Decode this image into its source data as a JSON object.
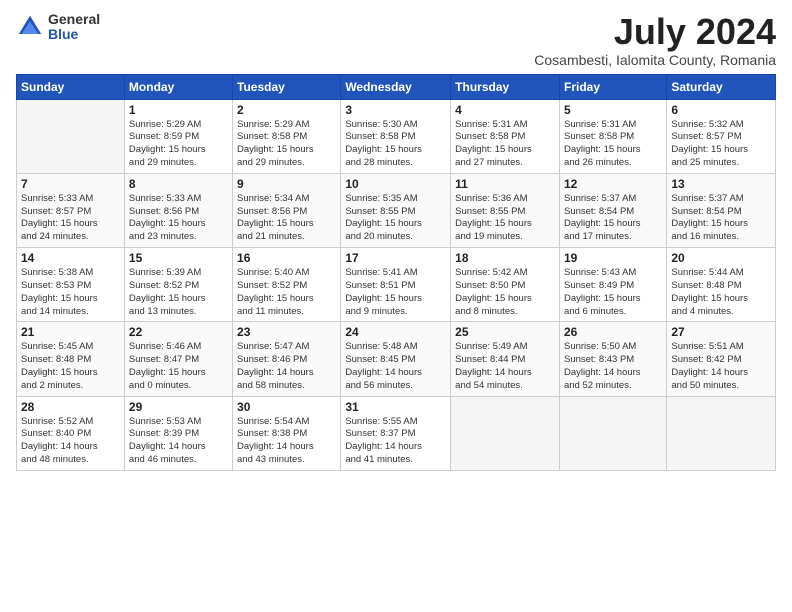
{
  "logo": {
    "general": "General",
    "blue": "Blue"
  },
  "title": "July 2024",
  "location": "Cosambesti, Ialomita County, Romania",
  "days_header": [
    "Sunday",
    "Monday",
    "Tuesday",
    "Wednesday",
    "Thursday",
    "Friday",
    "Saturday"
  ],
  "weeks": [
    [
      {
        "day": "",
        "info": ""
      },
      {
        "day": "1",
        "info": "Sunrise: 5:29 AM\nSunset: 8:59 PM\nDaylight: 15 hours\nand 29 minutes."
      },
      {
        "day": "2",
        "info": "Sunrise: 5:29 AM\nSunset: 8:58 PM\nDaylight: 15 hours\nand 29 minutes."
      },
      {
        "day": "3",
        "info": "Sunrise: 5:30 AM\nSunset: 8:58 PM\nDaylight: 15 hours\nand 28 minutes."
      },
      {
        "day": "4",
        "info": "Sunrise: 5:31 AM\nSunset: 8:58 PM\nDaylight: 15 hours\nand 27 minutes."
      },
      {
        "day": "5",
        "info": "Sunrise: 5:31 AM\nSunset: 8:58 PM\nDaylight: 15 hours\nand 26 minutes."
      },
      {
        "day": "6",
        "info": "Sunrise: 5:32 AM\nSunset: 8:57 PM\nDaylight: 15 hours\nand 25 minutes."
      }
    ],
    [
      {
        "day": "7",
        "info": "Sunrise: 5:33 AM\nSunset: 8:57 PM\nDaylight: 15 hours\nand 24 minutes."
      },
      {
        "day": "8",
        "info": "Sunrise: 5:33 AM\nSunset: 8:56 PM\nDaylight: 15 hours\nand 23 minutes."
      },
      {
        "day": "9",
        "info": "Sunrise: 5:34 AM\nSunset: 8:56 PM\nDaylight: 15 hours\nand 21 minutes."
      },
      {
        "day": "10",
        "info": "Sunrise: 5:35 AM\nSunset: 8:55 PM\nDaylight: 15 hours\nand 20 minutes."
      },
      {
        "day": "11",
        "info": "Sunrise: 5:36 AM\nSunset: 8:55 PM\nDaylight: 15 hours\nand 19 minutes."
      },
      {
        "day": "12",
        "info": "Sunrise: 5:37 AM\nSunset: 8:54 PM\nDaylight: 15 hours\nand 17 minutes."
      },
      {
        "day": "13",
        "info": "Sunrise: 5:37 AM\nSunset: 8:54 PM\nDaylight: 15 hours\nand 16 minutes."
      }
    ],
    [
      {
        "day": "14",
        "info": "Sunrise: 5:38 AM\nSunset: 8:53 PM\nDaylight: 15 hours\nand 14 minutes."
      },
      {
        "day": "15",
        "info": "Sunrise: 5:39 AM\nSunset: 8:52 PM\nDaylight: 15 hours\nand 13 minutes."
      },
      {
        "day": "16",
        "info": "Sunrise: 5:40 AM\nSunset: 8:52 PM\nDaylight: 15 hours\nand 11 minutes."
      },
      {
        "day": "17",
        "info": "Sunrise: 5:41 AM\nSunset: 8:51 PM\nDaylight: 15 hours\nand 9 minutes."
      },
      {
        "day": "18",
        "info": "Sunrise: 5:42 AM\nSunset: 8:50 PM\nDaylight: 15 hours\nand 8 minutes."
      },
      {
        "day": "19",
        "info": "Sunrise: 5:43 AM\nSunset: 8:49 PM\nDaylight: 15 hours\nand 6 minutes."
      },
      {
        "day": "20",
        "info": "Sunrise: 5:44 AM\nSunset: 8:48 PM\nDaylight: 15 hours\nand 4 minutes."
      }
    ],
    [
      {
        "day": "21",
        "info": "Sunrise: 5:45 AM\nSunset: 8:48 PM\nDaylight: 15 hours\nand 2 minutes."
      },
      {
        "day": "22",
        "info": "Sunrise: 5:46 AM\nSunset: 8:47 PM\nDaylight: 15 hours\nand 0 minutes."
      },
      {
        "day": "23",
        "info": "Sunrise: 5:47 AM\nSunset: 8:46 PM\nDaylight: 14 hours\nand 58 minutes."
      },
      {
        "day": "24",
        "info": "Sunrise: 5:48 AM\nSunset: 8:45 PM\nDaylight: 14 hours\nand 56 minutes."
      },
      {
        "day": "25",
        "info": "Sunrise: 5:49 AM\nSunset: 8:44 PM\nDaylight: 14 hours\nand 54 minutes."
      },
      {
        "day": "26",
        "info": "Sunrise: 5:50 AM\nSunset: 8:43 PM\nDaylight: 14 hours\nand 52 minutes."
      },
      {
        "day": "27",
        "info": "Sunrise: 5:51 AM\nSunset: 8:42 PM\nDaylight: 14 hours\nand 50 minutes."
      }
    ],
    [
      {
        "day": "28",
        "info": "Sunrise: 5:52 AM\nSunset: 8:40 PM\nDaylight: 14 hours\nand 48 minutes."
      },
      {
        "day": "29",
        "info": "Sunrise: 5:53 AM\nSunset: 8:39 PM\nDaylight: 14 hours\nand 46 minutes."
      },
      {
        "day": "30",
        "info": "Sunrise: 5:54 AM\nSunset: 8:38 PM\nDaylight: 14 hours\nand 43 minutes."
      },
      {
        "day": "31",
        "info": "Sunrise: 5:55 AM\nSunset: 8:37 PM\nDaylight: 14 hours\nand 41 minutes."
      },
      {
        "day": "",
        "info": ""
      },
      {
        "day": "",
        "info": ""
      },
      {
        "day": "",
        "info": ""
      }
    ]
  ]
}
